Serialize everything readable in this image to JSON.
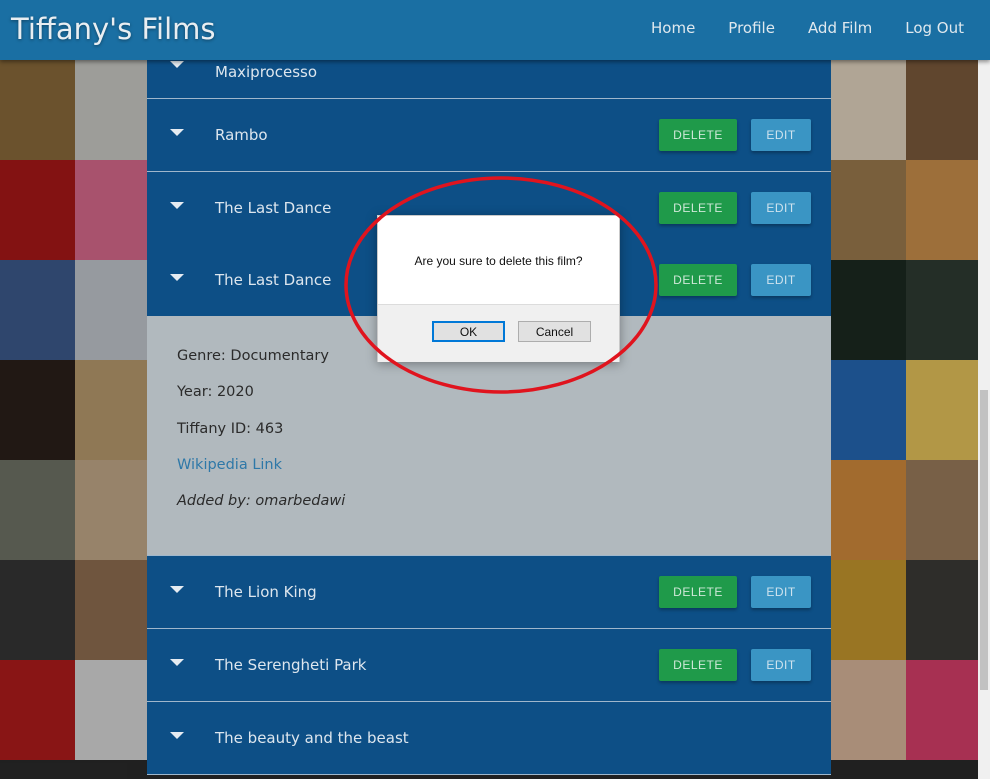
{
  "app": {
    "brand": "Tiffany's Films"
  },
  "nav": {
    "links": [
      "Home",
      "Profile",
      "Add Film",
      "Log Out"
    ]
  },
  "films": [
    {
      "title": "Maxiprocesso"
    },
    {
      "title": "Rambo"
    },
    {
      "title": "The Last Dance"
    },
    {
      "title": "The Last Dance"
    },
    {
      "title": "The Lion King"
    },
    {
      "title": "The Serengheti Park"
    },
    {
      "title": "The beauty and the beast"
    }
  ],
  "buttons": {
    "delete": "DELETE",
    "edit": "EDIT"
  },
  "details": {
    "genre": "Genre: Documentary",
    "year": "Year: 2020",
    "tiffany_id": "Tiffany ID: 463",
    "wiki": "Wikipedia Link",
    "added_by": "Added by: omarbedawi"
  },
  "dialog": {
    "message": "Are you sure to delete this film?",
    "ok": "OK",
    "cancel": "Cancel"
  },
  "colors": {
    "navbar": "#1a6fa3",
    "item_bg": "#0d4f86",
    "delete": "#1f9a4a",
    "edit": "#3a95c4",
    "annotation": "#e0141e"
  }
}
